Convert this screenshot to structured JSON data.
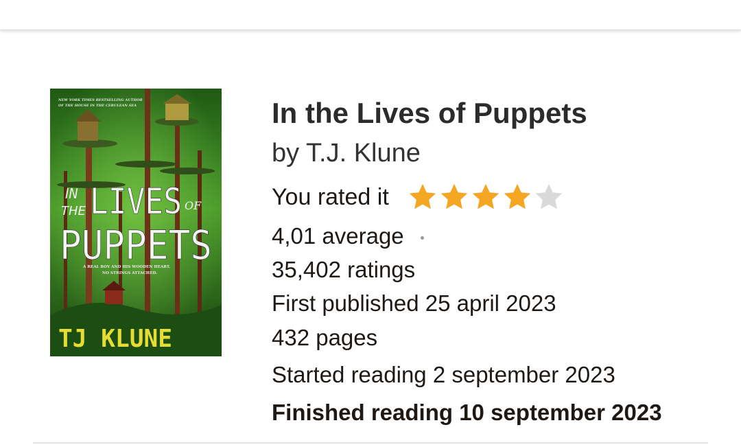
{
  "book": {
    "title": "In the Lives of Puppets",
    "by_prefix": "by",
    "author": "T.J. Klune"
  },
  "user_rating": {
    "label": "You rated it",
    "stars": 4,
    "max_stars": 5,
    "filled_color": "#f5a623",
    "empty_color": "#d9d9d9"
  },
  "stats": {
    "average": "4,01 average",
    "ratings": "35,402 ratings",
    "first_published": "First published 25 april 2023",
    "pages": "432 pages"
  },
  "reading": {
    "started": "Started reading 2 september 2023",
    "finished": "Finished reading 10 september 2023"
  },
  "cover": {
    "tagline_top_1": "NEW YORK TIMES BESTSELLING AUTHOR",
    "tagline_top_2": "OF THE HOUSE IN THE CERULEAN SEA",
    "word_in": "IN",
    "word_the": "THE",
    "word_lives": "LIVES",
    "word_of": "OF",
    "word_puppets": "PUPPETS",
    "subtitle_1": "A REAL BOY AND HIS WOODEN HEART.",
    "subtitle_2": "NO STRINGS ATTACHED.",
    "author_text": "TJ KLUNE",
    "bg_color": "#3d8a24",
    "author_color": "#e6dc32"
  }
}
